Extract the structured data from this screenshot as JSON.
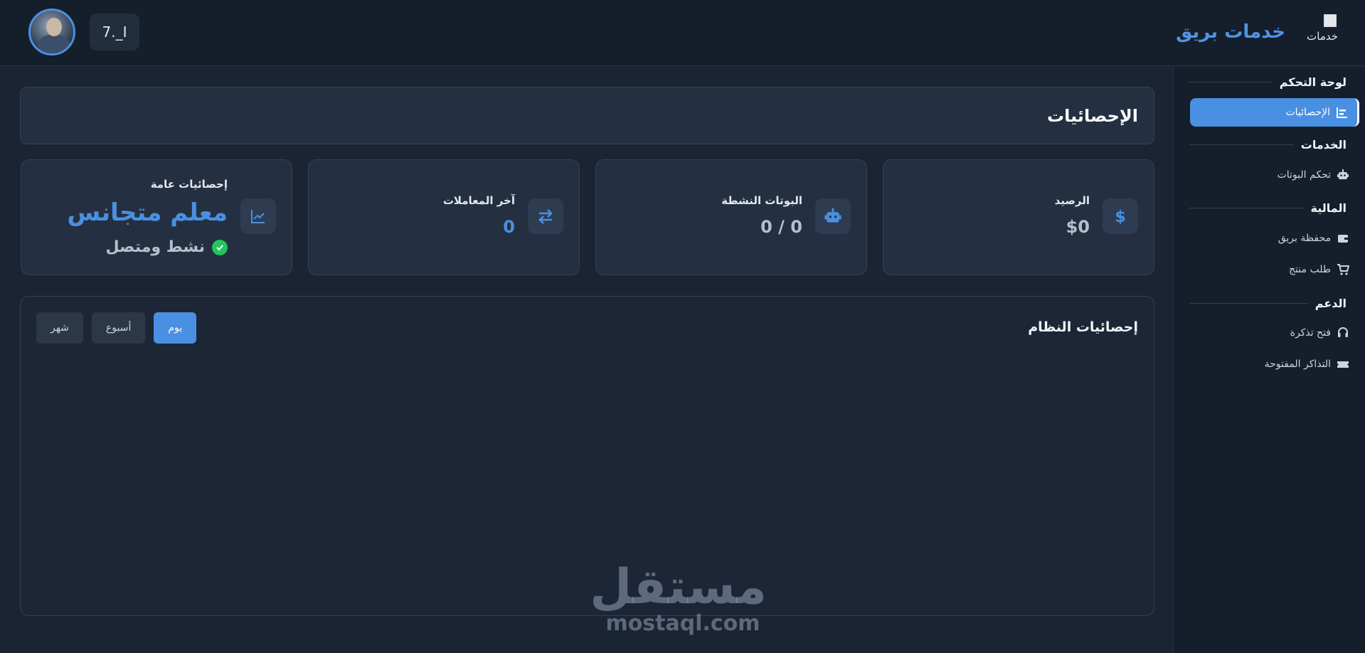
{
  "app": {
    "brand_title": "خدمات بريق",
    "logo_alt": "خدمات",
    "user_label": "7._I"
  },
  "sidebar": {
    "sections": [
      {
        "label": "لوحة التحكم"
      },
      {
        "label": "الخدمات"
      },
      {
        "label": "المالية"
      },
      {
        "label": "الدعم"
      }
    ],
    "items": [
      {
        "label": "الإحصائيات",
        "icon": "chart-icon",
        "active": true
      },
      {
        "label": "تحكم البوتات",
        "icon": "robot-icon"
      },
      {
        "label": "محفظة بريق",
        "icon": "wallet-icon"
      },
      {
        "label": "طلب منتج",
        "icon": "cart-icon"
      },
      {
        "label": "فتح تذكرة",
        "icon": "headset-icon"
      },
      {
        "label": "التذاكر المفتوحة",
        "icon": "ticket-icon"
      }
    ]
  },
  "page": {
    "title": "الإحصائيات"
  },
  "cards": {
    "balance": {
      "title": "الرصيد",
      "value": "$0",
      "icon": "dollar-icon"
    },
    "bots": {
      "title": "البوتات النشطة",
      "value": "0 / 0",
      "icon": "robot-icon"
    },
    "transactions": {
      "title": "آخر المعاملات",
      "value": "0",
      "icon": "exchange-icon"
    },
    "general": {
      "title": "إحصائيات عامة",
      "name": "معلم متجانس",
      "status": "نشط ومتصل",
      "icon": "line-chart-icon"
    }
  },
  "system_stats": {
    "title": "إحصائيات النظام",
    "ranges": [
      "يوم",
      "أسبوع",
      "شهر"
    ],
    "active_range": "يوم"
  },
  "watermark": {
    "arabic": "مستقل",
    "latin": "mostaql.com"
  },
  "colors": {
    "accent": "#4a90e2",
    "success": "#22c55e",
    "background": "#1a2433"
  }
}
